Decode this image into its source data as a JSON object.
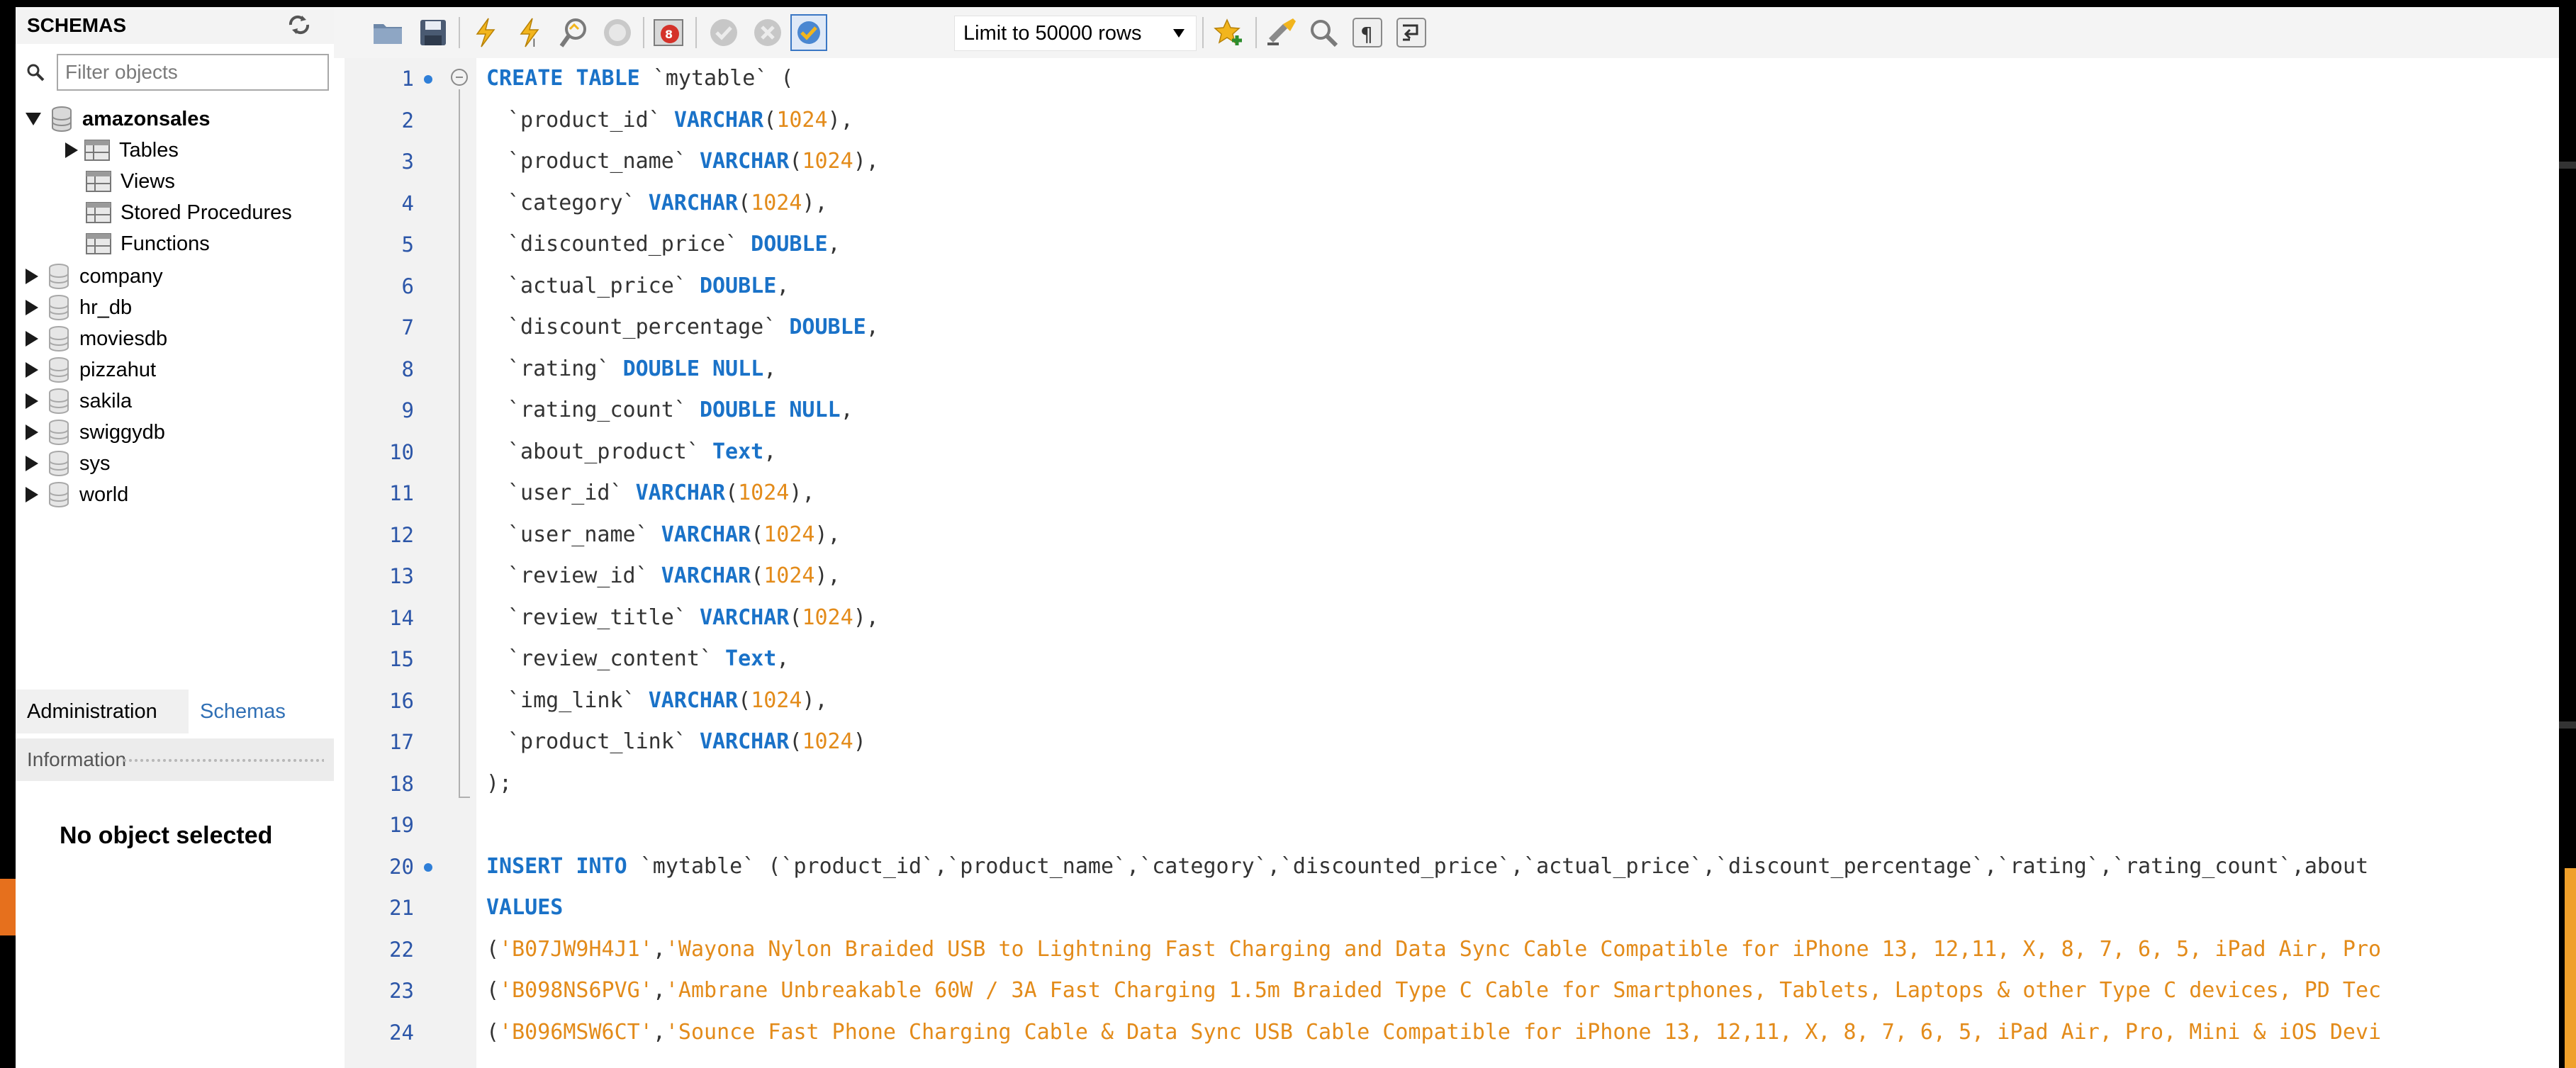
{
  "sidebar": {
    "title": "SCHEMAS",
    "filter_placeholder": "Filter objects",
    "schemas": [
      {
        "name": "amazonsales",
        "expanded": true,
        "children": [
          "Tables",
          "Views",
          "Stored Procedures",
          "Functions"
        ]
      },
      {
        "name": "company"
      },
      {
        "name": "hr_db"
      },
      {
        "name": "moviesdb"
      },
      {
        "name": "pizzahut"
      },
      {
        "name": "sakila"
      },
      {
        "name": "swiggydb"
      },
      {
        "name": "sys"
      },
      {
        "name": "world"
      }
    ],
    "tabs": [
      "Administration",
      "Schemas"
    ],
    "info_label": "Information",
    "no_object": "No object selected"
  },
  "toolbar": {
    "limit_label": "Limit to 50000 rows",
    "icons": [
      "open-folder-icon",
      "save-icon",
      "execute-icon",
      "execute-current-icon",
      "explain-icon",
      "stop-icon",
      "toggle-stop-on-error-icon",
      "commit-icon",
      "rollback-icon",
      "autocommit-icon",
      "limit-dropdown",
      "bookmark-icon",
      "beautify-icon",
      "find-icon",
      "invisible-chars-icon",
      "wrap-icon"
    ]
  },
  "editor": {
    "lines": [
      {
        "n": "1",
        "marker": true,
        "fold": true,
        "code": "CREATE TABLE `mytable` ("
      },
      {
        "n": "2",
        "code": "`product_id` VARCHAR(1024),"
      },
      {
        "n": "3",
        "code": "`product_name` VARCHAR(1024),"
      },
      {
        "n": "4",
        "code": "`category` VARCHAR(1024),"
      },
      {
        "n": "5",
        "code": "`discounted_price` DOUBLE,"
      },
      {
        "n": "6",
        "code": "`actual_price` DOUBLE,"
      },
      {
        "n": "7",
        "code": "`discount_percentage` DOUBLE,"
      },
      {
        "n": "8",
        "code": "`rating` DOUBLE NULL,"
      },
      {
        "n": "9",
        "code": "`rating_count` DOUBLE NULL,"
      },
      {
        "n": "10",
        "code": "`about_product` Text,"
      },
      {
        "n": "11",
        "code": "`user_id` VARCHAR(1024),"
      },
      {
        "n": "12",
        "code": "`user_name` VARCHAR(1024),"
      },
      {
        "n": "13",
        "code": "`review_id` VARCHAR(1024),"
      },
      {
        "n": "14",
        "code": "`review_title` VARCHAR(1024),"
      },
      {
        "n": "15",
        "code": "`review_content` Text,"
      },
      {
        "n": "16",
        "code": "`img_link` VARCHAR(1024),"
      },
      {
        "n": "17",
        "code": "`product_link` VARCHAR(1024)"
      },
      {
        "n": "18",
        "code": ");"
      },
      {
        "n": "19",
        "code": ""
      },
      {
        "n": "20",
        "marker": true,
        "code": "INSERT INTO `mytable` (`product_id`,`product_name`,`category`,`discounted_price`,`actual_price`,`discount_percentage`,`rating`,`rating_count`,`about"
      },
      {
        "n": "21",
        "code": "VALUES"
      },
      {
        "n": "22",
        "code": "('B07JW9H4J1','Wayona Nylon Braided USB to Lightning Fast Charging and Data Sync Cable Compatible for iPhone 13, 12,11, X, 8, 7, 6, 5, iPad Air, Pro"
      },
      {
        "n": "23",
        "code": "('B098NS6PVG','Ambrane Unbreakable 60W / 3A Fast Charging 1.5m Braided Type C Cable for Smartphones, Tablets, Laptops & other Type C devices, PD Tec"
      },
      {
        "n": "24",
        "code": "('B096MSW6CT','Sounce Fast Phone Charging Cable & Data Sync USB Cable Compatible for iPhone 13, 12,11, X, 8, 7, 6, 5, iPad Air, Pro, Mini & iOS Devi"
      }
    ]
  },
  "colors": {
    "keyword": "#1a72c8",
    "number": "#e38b1a",
    "string": "#e38b1a",
    "line_number": "#2c56a8",
    "gutter": "#f2f2f2",
    "tab_active_text": "#2f6fb5"
  }
}
